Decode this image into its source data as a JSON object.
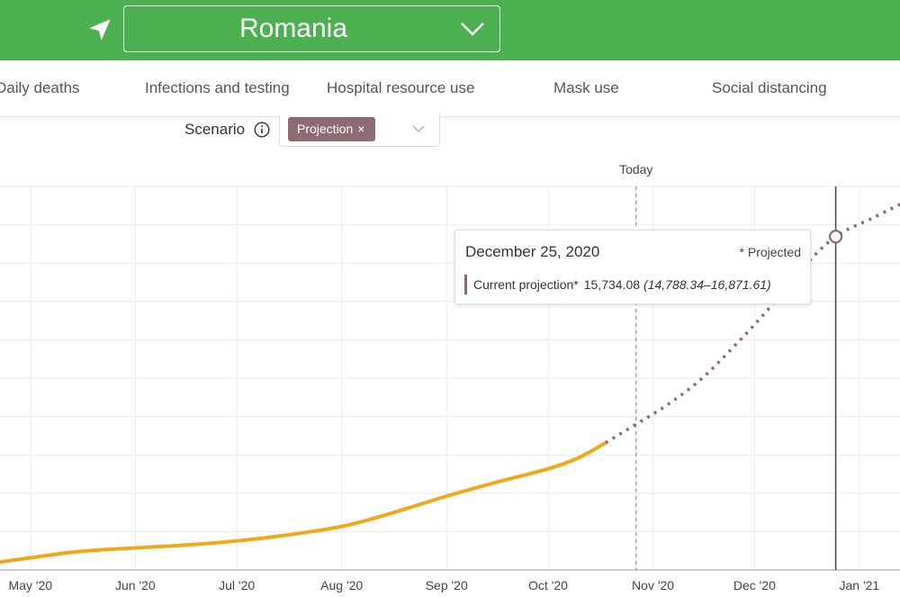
{
  "header": {
    "country": "Romania",
    "location_icon": "navigation-arrow-icon",
    "dropdown_icon": "chevron-down-icon"
  },
  "tabs": [
    {
      "label": "Daily deaths"
    },
    {
      "label": "Infections and testing"
    },
    {
      "label": "Hospital resource use"
    },
    {
      "label": "Mask use"
    },
    {
      "label": "Social distancing"
    }
  ],
  "scenario": {
    "label": "Scenario",
    "info_icon": "info-icon",
    "selected_chip": "Projection",
    "chip_close": "×",
    "dropdown_icon": "chevron-down-icon"
  },
  "tooltip": {
    "date": "December 25, 2020",
    "note": "* Projected",
    "series_label": "Current projection*",
    "value": "15,734.08",
    "range": "(14,788.34–16,871.61)"
  },
  "colors": {
    "header_bg": "#4caf50",
    "observed_line": "#f0a818",
    "projection_line": "#8e6a73",
    "chip_bg": "#8e6a73"
  },
  "chart_data": {
    "type": "line",
    "x_ticks": [
      "May '20",
      "Jun '20",
      "Jul '20",
      "Aug '20",
      "Sep '20",
      "Oct '20",
      "Nov '20",
      "Dec '20",
      "Jan '21"
    ],
    "x_range": [
      "2020-04-22",
      "2021-01-13"
    ],
    "grid": true,
    "today_label": "Today",
    "today_date": "2020-10-27",
    "hover_date": "2020-12-25",
    "series": [
      {
        "name": "Observed",
        "style": "solid",
        "points": [
          [
            "2020-04-22",
            1500
          ],
          [
            "2020-05-01",
            1760
          ],
          [
            "2020-05-15",
            2150
          ],
          [
            "2020-06-01",
            2380
          ],
          [
            "2020-06-15",
            2550
          ],
          [
            "2020-07-01",
            2820
          ],
          [
            "2020-07-15",
            3160
          ],
          [
            "2020-08-01",
            3720
          ],
          [
            "2020-08-15",
            4510
          ],
          [
            "2020-09-01",
            5620
          ],
          [
            "2020-09-15",
            6450
          ],
          [
            "2020-10-01",
            7330
          ],
          [
            "2020-10-10",
            8020
          ],
          [
            "2020-10-18",
            8960
          ]
        ]
      },
      {
        "name": "Current projection*",
        "style": "dashed",
        "points": [
          [
            "2020-10-18",
            8960
          ],
          [
            "2020-10-27",
            10120
          ],
          [
            "2020-11-05",
            11300
          ],
          [
            "2020-11-15",
            12900
          ],
          [
            "2020-11-25",
            15000
          ],
          [
            "2020-12-05",
            17300
          ],
          [
            "2020-12-15",
            19850
          ],
          [
            "2020-12-25",
            21860
          ],
          [
            "2021-01-05",
            23030
          ],
          [
            "2021-01-13",
            23880
          ]
        ]
      }
    ],
    "hover_point": [
      "2020-12-25",
      21860
    ]
  }
}
